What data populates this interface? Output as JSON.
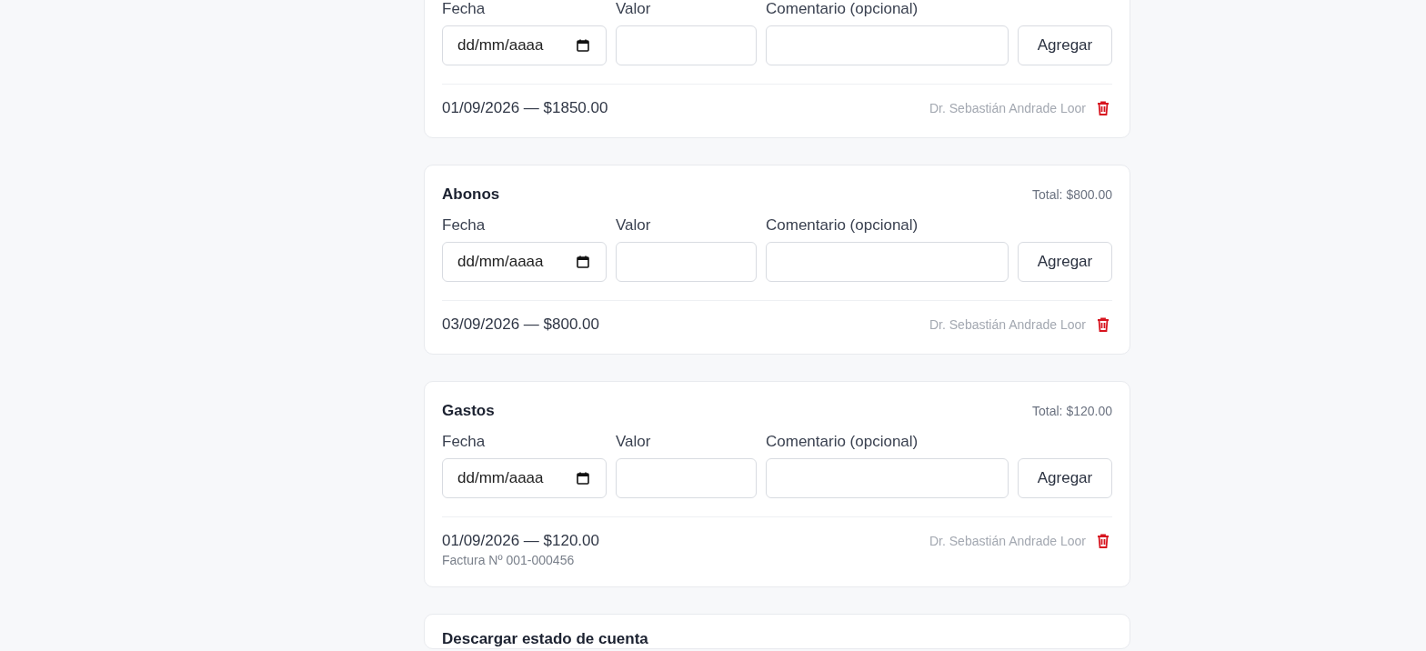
{
  "sections": [
    {
      "fields": [
        {
          "label": "Fecha",
          "kind": "date",
          "placeholder": "dd/mm/aaaa"
        },
        {
          "label": "Valor",
          "kind": "text"
        },
        {
          "label": "Comentario (opcional)",
          "kind": "text"
        }
      ],
      "button": "Agregar",
      "entries": [
        {
          "text": "01/09/2026 — $1850.00",
          "author": "Dr. Sebastián Andrade Loor"
        }
      ]
    },
    {
      "title": "Abonos",
      "total": "Total: $800.00",
      "fields": [
        {
          "label": "Fecha",
          "kind": "date",
          "placeholder": "dd/mm/aaaa"
        },
        {
          "label": "Valor",
          "kind": "text"
        },
        {
          "label": "Comentario (opcional)",
          "kind": "text"
        }
      ],
      "button": "Agregar",
      "entries": [
        {
          "text": "03/09/2026 — $800.00",
          "author": "Dr. Sebastián Andrade Loor"
        }
      ]
    },
    {
      "title": "Gastos",
      "total": "Total: $120.00",
      "fields": [
        {
          "label": "Fecha",
          "kind": "date",
          "placeholder": "dd/mm/aaaa"
        },
        {
          "label": "Valor",
          "kind": "text"
        },
        {
          "label": "Comentario (opcional)",
          "kind": "text"
        }
      ],
      "button": "Agregar",
      "entries": [
        {
          "text": "01/09/2026 — $120.00",
          "note": "Factura Nº 001-000456",
          "author": "Dr. Sebastián Andrade Loor"
        }
      ]
    },
    {
      "title": "Descargar estado de cuenta"
    }
  ]
}
